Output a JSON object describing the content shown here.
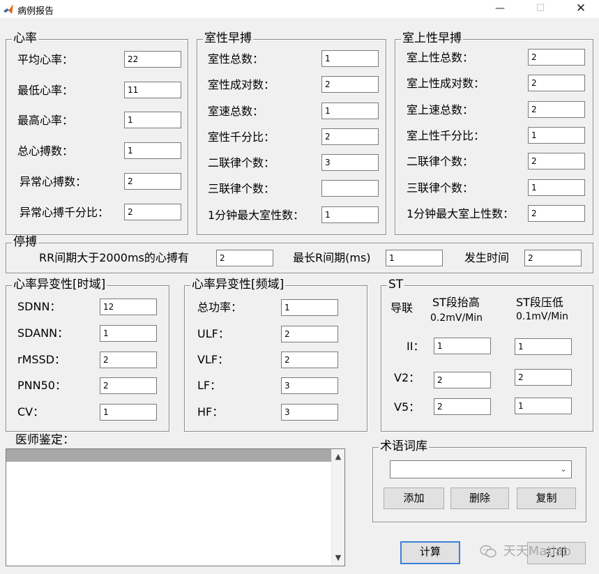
{
  "window": {
    "title": "病例报告",
    "minimize": "—",
    "maximize": "☐",
    "close": "✕"
  },
  "heart_rate": {
    "title": "心率",
    "rows": [
      {
        "label": "平均心率：",
        "value": "22"
      },
      {
        "label": "最低心率：",
        "value": "11"
      },
      {
        "label": "最高心率：",
        "value": "1"
      },
      {
        "label": "总心搏数：",
        "value": "1"
      },
      {
        "label": "异常心搏数：",
        "value": "2"
      },
      {
        "label": "异常心搏千分比：",
        "value": "2"
      }
    ]
  },
  "ventricular": {
    "title": "室性早搏",
    "rows": [
      {
        "label": "室性总数：",
        "value": "1"
      },
      {
        "label": "室性成对数：",
        "value": "2"
      },
      {
        "label": "室速总数：",
        "value": "1"
      },
      {
        "label": "室性千分比：",
        "value": "2"
      },
      {
        "label": "二联律个数：",
        "value": "3"
      },
      {
        "label": "三联律个数：",
        "value": ""
      },
      {
        "label": "1分钟最大室性数：",
        "value": "1"
      }
    ]
  },
  "supraventricular": {
    "title": "室上性早搏",
    "rows": [
      {
        "label": "室上性总数：",
        "value": "2"
      },
      {
        "label": "室上性成对数：",
        "value": "2"
      },
      {
        "label": "室上速总数：",
        "value": "2"
      },
      {
        "label": "室上性千分比：",
        "value": "1"
      },
      {
        "label": "二联律个数：",
        "value": "2"
      },
      {
        "label": "三联律个数：",
        "value": "1"
      },
      {
        "label": "1分钟最大室上性数：",
        "value": "2"
      }
    ]
  },
  "pause": {
    "title": "停搏",
    "rr_label": "RR间期大于2000ms的心搏有",
    "rr_value": "2",
    "longest_label": "最长R间期(ms)",
    "longest_value": "1",
    "time_label": "发生时间",
    "time_value": "2"
  },
  "hrv_time": {
    "title": "心率异变性[时域]",
    "rows": [
      {
        "label": "SDNN：",
        "value": "12"
      },
      {
        "label": "SDANN：",
        "value": "1"
      },
      {
        "label": "rMSSD：",
        "value": "2"
      },
      {
        "label": "PNN50：",
        "value": "2"
      },
      {
        "label": "CV：",
        "value": "1"
      }
    ]
  },
  "hrv_freq": {
    "title": "心率异变性[频域]",
    "rows": [
      {
        "label": "总功率：",
        "value": "1"
      },
      {
        "label": "ULF：",
        "value": "2"
      },
      {
        "label": "VLF：",
        "value": "2"
      },
      {
        "label": "LF：",
        "value": "3"
      },
      {
        "label": "HF：",
        "value": "3"
      }
    ]
  },
  "st": {
    "title": "ST",
    "lead_header": "导联",
    "elev_header": "ST段抬高",
    "elev_unit": "0.2mV/Min",
    "dep_header": "ST段压低",
    "dep_unit": "0.1mV/Min",
    "rows": [
      {
        "lead": "II：",
        "elev": "1",
        "dep": "1"
      },
      {
        "lead": "V2：",
        "elev": "2",
        "dep": "2"
      },
      {
        "lead": "V5：",
        "elev": "2",
        "dep": "1"
      }
    ]
  },
  "doctor": {
    "label": "医师鉴定：",
    "text": ""
  },
  "terms": {
    "title": "术语词库",
    "selected": "",
    "add": "添加",
    "delete": "删除",
    "copy": "复制"
  },
  "actions": {
    "calculate": "计算",
    "print": "打印"
  },
  "watermark": "天天Matlab"
}
